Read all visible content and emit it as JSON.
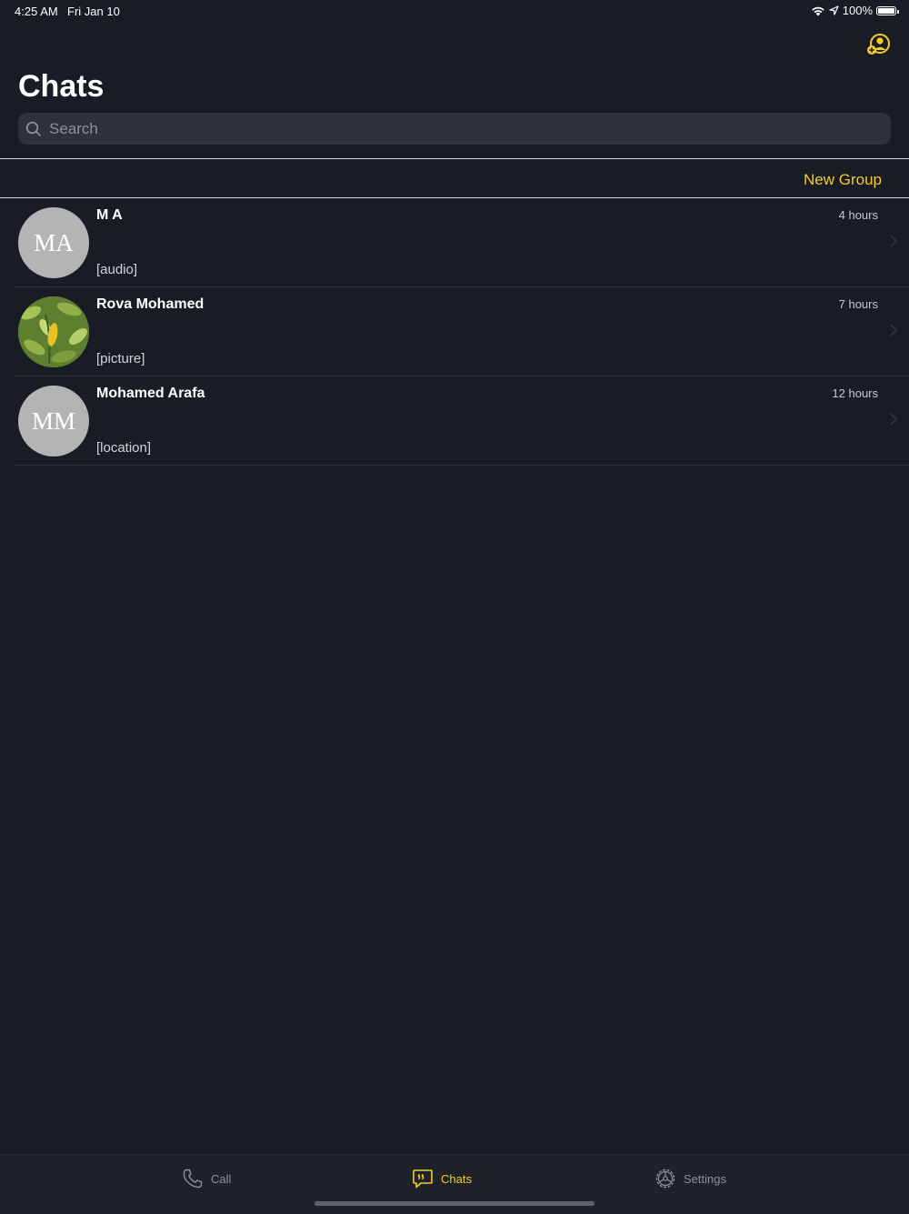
{
  "status_bar": {
    "time": "4:25 AM",
    "date": "Fri Jan 10",
    "battery": "100%",
    "icons": [
      "wifi-icon",
      "location-arrow-icon",
      "battery-icon"
    ]
  },
  "header": {
    "title": "Chats",
    "add_contact_icon": "add-contact-icon"
  },
  "search": {
    "placeholder": "Search",
    "value": ""
  },
  "actions": {
    "new_group": "New Group"
  },
  "chats": [
    {
      "avatar_initials": "MA",
      "name": "M A",
      "time": "4 hours",
      "preview": "[audio]"
    },
    {
      "avatar_initials": "",
      "avatar_image": "leaf-photo",
      "name": "Rova Mohamed",
      "time": "7 hours",
      "preview": "[picture]"
    },
    {
      "avatar_initials": "MM",
      "name": "Mohamed Arafa",
      "time": "12 hours",
      "preview": "[location]"
    }
  ],
  "tab_bar": {
    "tabs": [
      {
        "label": "Call",
        "icon": "phone-icon",
        "active": false
      },
      {
        "label": "Chats",
        "icon": "chat-bubble-icon",
        "active": true
      },
      {
        "label": "Settings",
        "icon": "gear-icon",
        "active": false
      }
    ]
  },
  "colors": {
    "background": "#191c25",
    "accent": "#f4cd2a",
    "search_bg": "#2f323a",
    "avatar_bg": "#b4b4b4",
    "tab_bar_bg": "#1f222a"
  }
}
